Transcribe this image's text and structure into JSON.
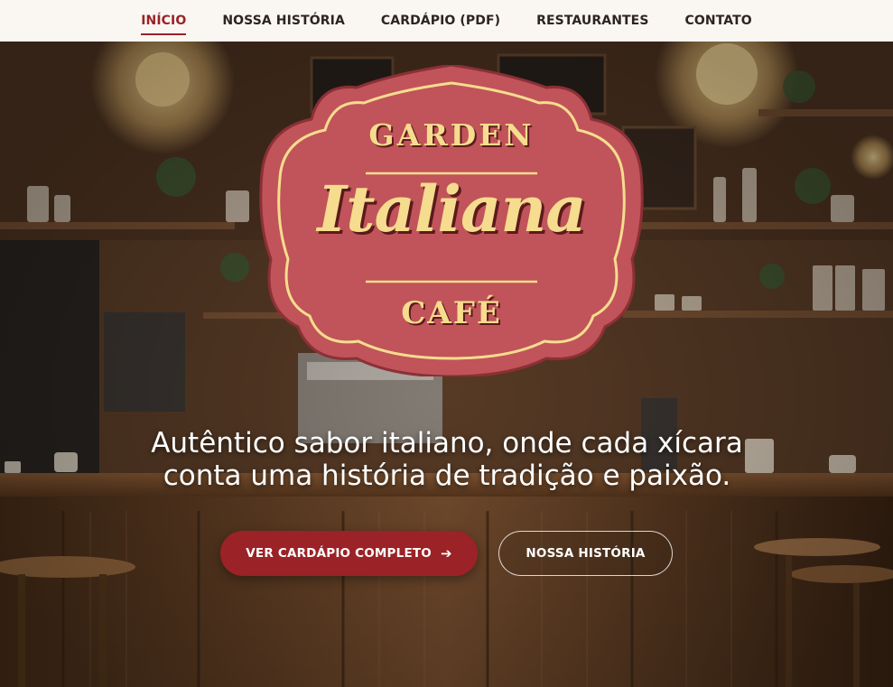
{
  "nav": {
    "items": [
      {
        "label": "INÍCIO",
        "active": true
      },
      {
        "label": "NOSSA HISTÓRIA",
        "active": false
      },
      {
        "label": "CARDÁPIO (PDF)",
        "active": false
      },
      {
        "label": "RESTAURANTES",
        "active": false
      },
      {
        "label": "CONTATO",
        "active": false
      }
    ]
  },
  "logo": {
    "top_word": "GARDEN",
    "main_word": "Italiana",
    "bottom_word": "CAFÉ"
  },
  "hero": {
    "tagline_line1": "Autêntico sabor italiano, onde cada xícara",
    "tagline_line2": "conta uma história de tradição e paixão."
  },
  "buttons": {
    "primary_label": "VER CARDÁPIO COMPLETO",
    "primary_icon": "arrow-right-icon",
    "secondary_label": "NOSSA HISTÓRIA"
  },
  "colors": {
    "accent": "#9b2226",
    "nav_bg": "#faf7f2",
    "logo_badge": "#c0545a",
    "logo_text": "#f6dc8e"
  }
}
